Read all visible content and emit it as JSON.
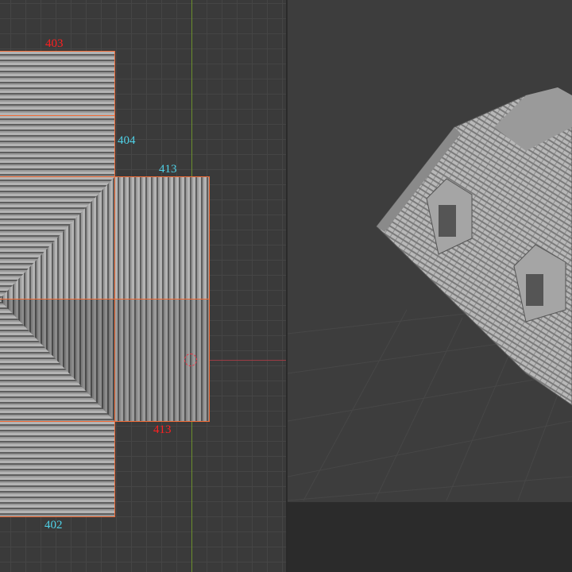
{
  "left_viewport": {
    "view": "top orthographic",
    "labels": {
      "panel_403": "403",
      "panel_404": "404",
      "panel_413_top": "413",
      "panel_413_bottom": "413",
      "panel_402": "402"
    },
    "colors": {
      "selection_outline": "#f06a35",
      "label_red": "#ff2020",
      "label_cyan": "#4fd2e8",
      "axis_y": "#6b8f2c",
      "axis_x": "#9b3c44"
    }
  },
  "right_viewport": {
    "view": "perspective",
    "object": "roof with dormer windows"
  }
}
